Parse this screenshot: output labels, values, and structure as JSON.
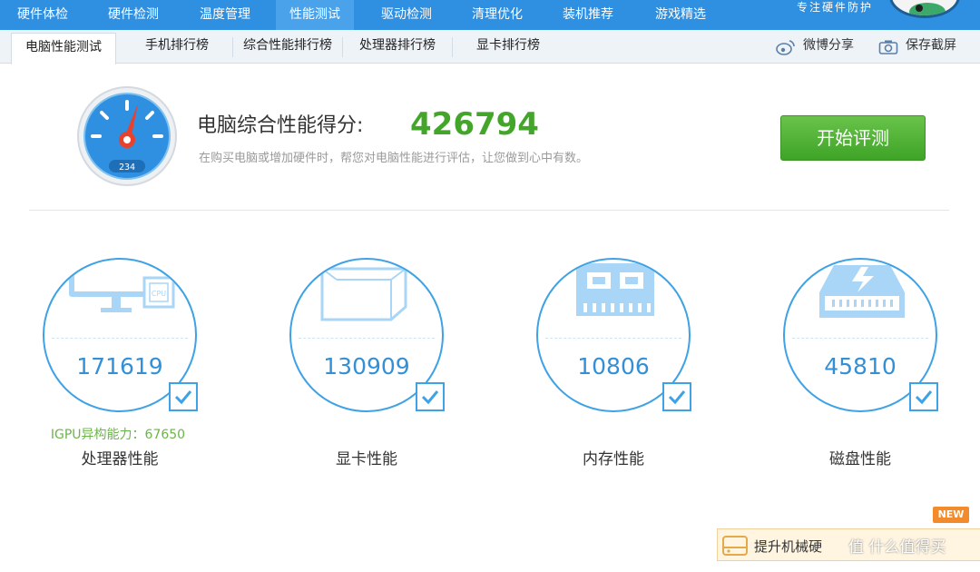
{
  "nav": {
    "tabs": [
      {
        "label": "硬件体检",
        "active": false
      },
      {
        "label": "硬件检测",
        "active": false
      },
      {
        "label": "温度管理",
        "active": false
      },
      {
        "label": "性能测试",
        "active": true
      },
      {
        "label": "驱动检测",
        "active": false
      },
      {
        "label": "清理优化",
        "active": false
      },
      {
        "label": "装机推荐",
        "active": false
      },
      {
        "label": "游戏精选",
        "active": false
      }
    ],
    "brand": "专注硬件防护"
  },
  "subnav": {
    "tabs": [
      {
        "label": "电脑性能测试",
        "active": true
      },
      {
        "label": "手机排行榜",
        "active": false
      },
      {
        "label": "综合性能排行榜",
        "active": false
      },
      {
        "label": "处理器排行榜",
        "active": false
      },
      {
        "label": "显卡排行榜",
        "active": false
      }
    ],
    "weibo_share": "微博分享",
    "save_screenshot": "保存截屏"
  },
  "score": {
    "label": "电脑综合性能得分:",
    "value": "426794",
    "description": "在购买电脑或增加硬件时，帮您对电脑性能进行评估，让您做到心中有数。",
    "gauge_readout": "234"
  },
  "start_button": "开始评测",
  "tiles": [
    {
      "icon": "monitor-cpu-icon",
      "badge": "CPU",
      "value": "171619",
      "extra": "IGPU异构能力：67650",
      "label": "处理器性能",
      "checked": true
    },
    {
      "icon": "graphics-card-icon",
      "value": "130909",
      "label": "显卡性能",
      "checked": true
    },
    {
      "icon": "memory-chip-icon",
      "value": "10806",
      "label": "内存性能",
      "checked": true
    },
    {
      "icon": "hard-disk-icon",
      "value": "45810",
      "label": "磁盘性能",
      "checked": true
    }
  ],
  "promo": {
    "text": "提升机械硬",
    "new_badge": "NEW"
  },
  "watermark": "值 什么值得买"
}
